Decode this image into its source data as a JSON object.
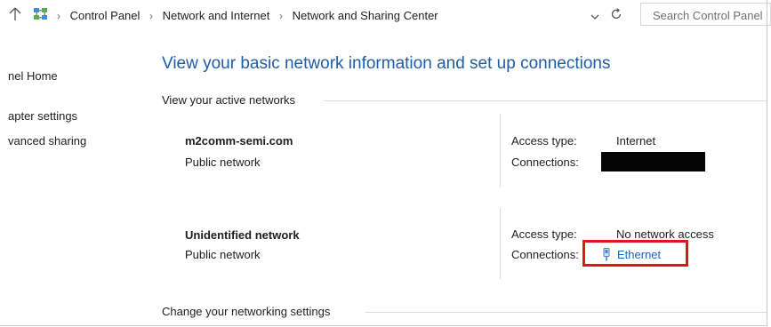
{
  "addressbar": {
    "breadcrumbs": [
      "Control Panel",
      "Network and Internet",
      "Network and Sharing Center"
    ],
    "search_placeholder": "Search Control Panel"
  },
  "leftpane": {
    "links": [
      "nel Home",
      "apter settings",
      "vanced sharing"
    ]
  },
  "main": {
    "heading": "View your basic network information and set up connections",
    "active_networks_label": "View your active networks",
    "change_settings_label": "Change your networking settings",
    "networks": [
      {
        "name": "m2comm-semi.com",
        "type": "Public network",
        "access_type_label": "Access type:",
        "access_type": "Internet",
        "connections_label": "Connections:",
        "connection": ""
      },
      {
        "name": "Unidentified network",
        "type": "Public network",
        "access_type_label": "Access type:",
        "access_type": "No network access",
        "connections_label": "Connections:",
        "connection": "Ethernet"
      }
    ]
  },
  "colors": {
    "heading": "#1e5ea8",
    "link": "#1a67c2",
    "highlight_box": "#e0141b",
    "redaction": "#050505"
  },
  "icons": [
    "up-arrow-icon",
    "control-panel-icon",
    "chevron-down-icon",
    "refresh-icon",
    "ethernet-icon"
  ]
}
